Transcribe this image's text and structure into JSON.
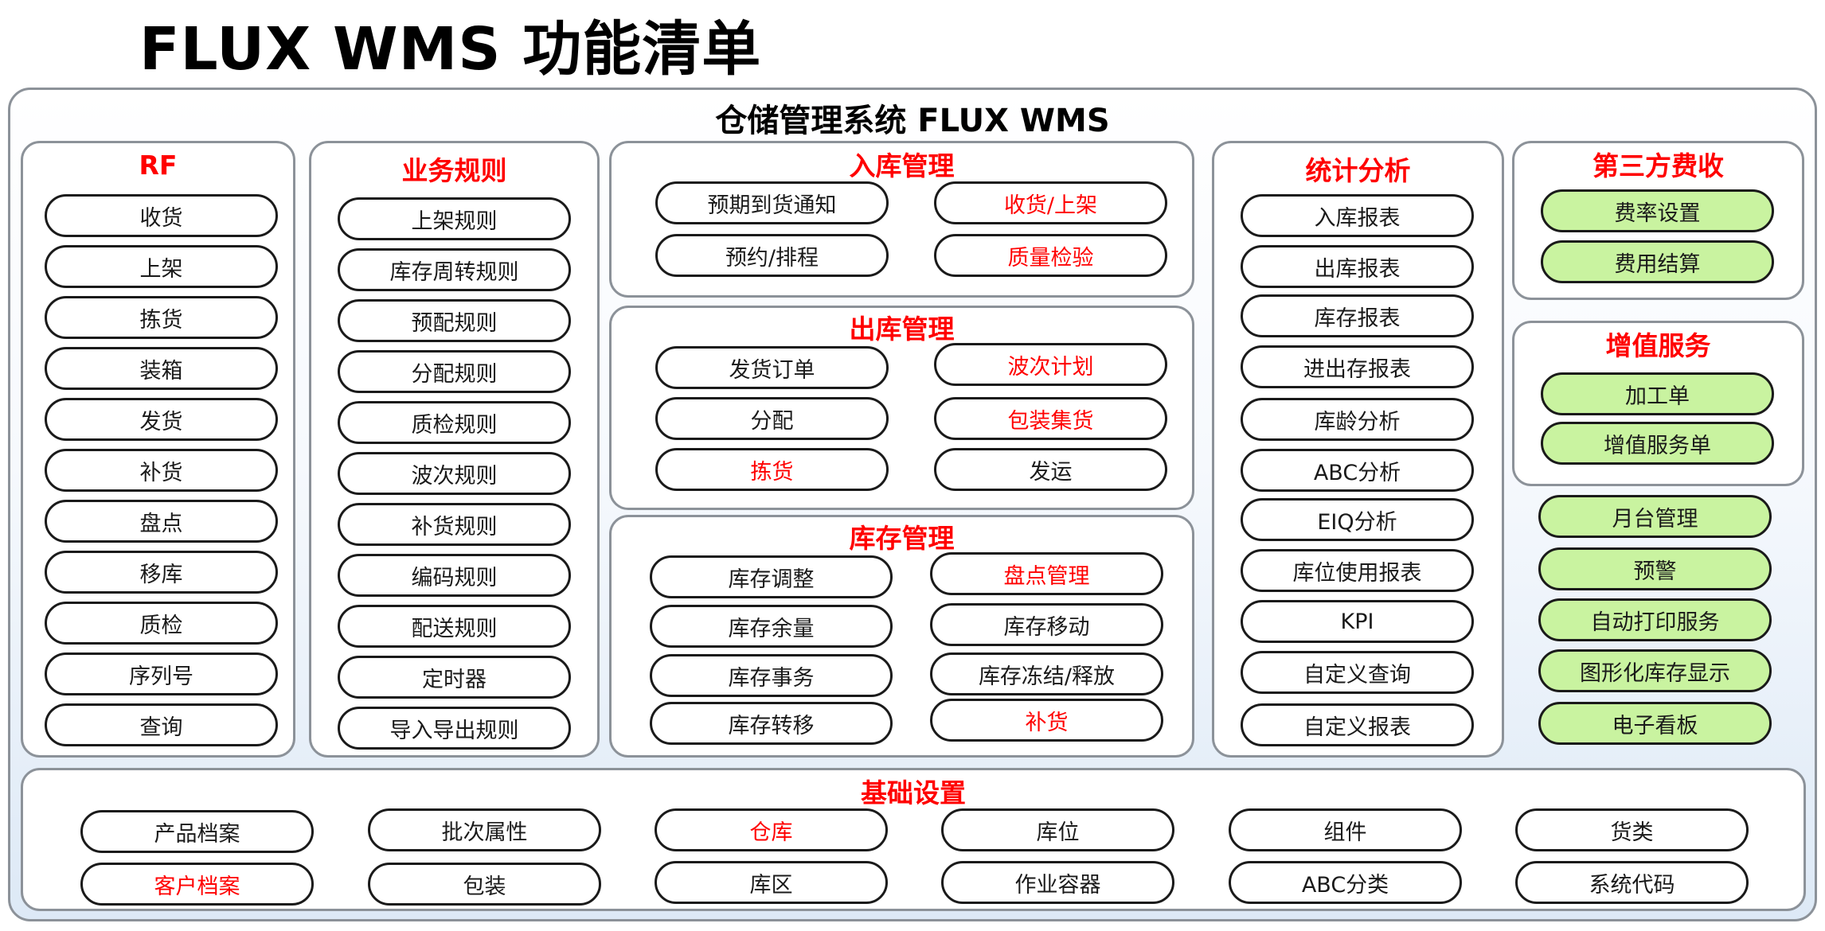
{
  "title": "FLUX WMS 功能清单",
  "system_title": "仓储管理系统 FLUX WMS",
  "rf": {
    "title": "RF",
    "items": [
      "收货",
      "上架",
      "拣货",
      "装箱",
      "发货",
      "补货",
      "盘点",
      "移库",
      "质检",
      "序列号",
      "查询"
    ]
  },
  "rules": {
    "title": "业务规则",
    "items": [
      "上架规则",
      "库存周转规则",
      "预配规则",
      "分配规则",
      "质检规则",
      "波次规则",
      "补货规则",
      "编码规则",
      "配送规则",
      "定时器",
      "导入导出规则"
    ]
  },
  "inbound": {
    "title": "入库管理",
    "items": [
      "预期到货通知",
      "收货/上架",
      "预约/排程",
      "质量检验"
    ]
  },
  "outbound": {
    "title": "出库管理",
    "items": [
      "发货订单",
      "波次计划",
      "分配",
      "包装集货",
      "拣货",
      "发运"
    ]
  },
  "inventory": {
    "title": "库存管理",
    "items": [
      "库存调整",
      "盘点管理",
      "库存余量",
      "库存移动",
      "库存事务",
      "库存冻结/释放",
      "库存转移",
      "补货"
    ]
  },
  "stats": {
    "title": "统计分析",
    "items": [
      "入库报表",
      "出库报表",
      "库存报表",
      "进出存报表",
      "库龄分析",
      "ABC分析",
      "EIQ分析",
      "库位使用报表",
      "KPI",
      "自定义查询",
      "自定义报表"
    ]
  },
  "billing": {
    "title": "第三方费收",
    "items": [
      "费率设置",
      "费用结算"
    ]
  },
  "vas": {
    "title": "增值服务",
    "items": [
      "加工单",
      "增值服务单"
    ]
  },
  "extras": {
    "items": [
      "月台管理",
      "预警",
      "自动打印服务",
      "图形化库存显示",
      "电子看板"
    ]
  },
  "basic": {
    "title": "基础设置",
    "row1": [
      "产品档案",
      "批次属性",
      "仓库",
      "库位",
      "组件",
      "货类"
    ],
    "row2": [
      "客户档案",
      "包装",
      "库区",
      "作业容器",
      "ABC分类",
      "系统代码"
    ]
  },
  "colors": {
    "highlight_text": "#ff0000",
    "green_fill": "#c9f3a0",
    "border": "#8c9299"
  }
}
